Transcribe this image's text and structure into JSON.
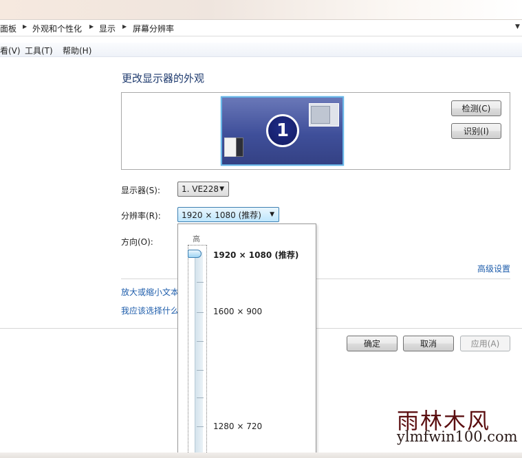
{
  "breadcrumb": {
    "items": [
      "面板",
      "外观和个性化",
      "显示",
      "屏幕分辨率"
    ]
  },
  "menubar": {
    "items": [
      "看(V)",
      "工具(T)",
      "帮助(H)"
    ]
  },
  "page": {
    "heading": "更改显示器的外观"
  },
  "preview": {
    "monitor_number": "1",
    "detect_button": "检测(C)",
    "identify_button": "识别(I)"
  },
  "form": {
    "display_label": "显示器(S):",
    "display_value": "1. VE228",
    "resolution_label": "分辨率(R):",
    "resolution_value": "1920 × 1080 (推荐)",
    "orientation_label": "方向(O):"
  },
  "links": {
    "advanced": "高级设置",
    "text_size": "放大或缩小文本",
    "which": "我应该选择什么"
  },
  "buttons": {
    "ok": "确定",
    "cancel": "取消",
    "apply": "应用(A)"
  },
  "resolution_dropdown": {
    "high_label": "高",
    "options": [
      "1920 × 1080 (推荐)",
      "1600 × 900",
      "1280 × 720"
    ],
    "selected_index": 0
  },
  "watermark": {
    "cn": "雨林木风",
    "en": "ylmfwin100.com"
  },
  "colors": {
    "link": "#1e5dab",
    "heading": "#1e3a6e",
    "monitor": "#3f4f9a",
    "highlight": "#3c7fb1"
  }
}
